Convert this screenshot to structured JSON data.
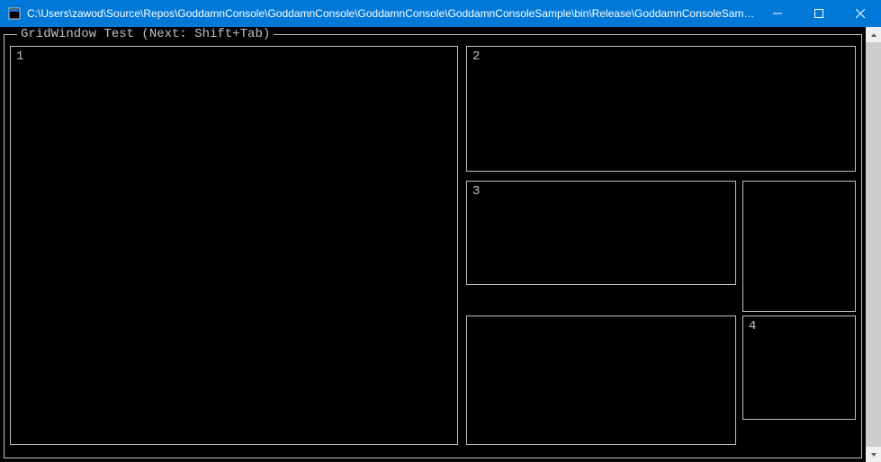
{
  "window": {
    "title": "C:\\Users\\zawod\\Source\\Repos\\GoddamnConsole\\GoddamnConsole\\GoddamnConsole\\GoddamnConsoleSample\\bin\\Release\\GoddamnConsoleSample.exe"
  },
  "frame": {
    "title": " GridWindow Test (Next: Shift+Tab) "
  },
  "panels": {
    "p1_label": "1",
    "p2_label": "2",
    "p3_label": "3",
    "p4_label": "4"
  }
}
